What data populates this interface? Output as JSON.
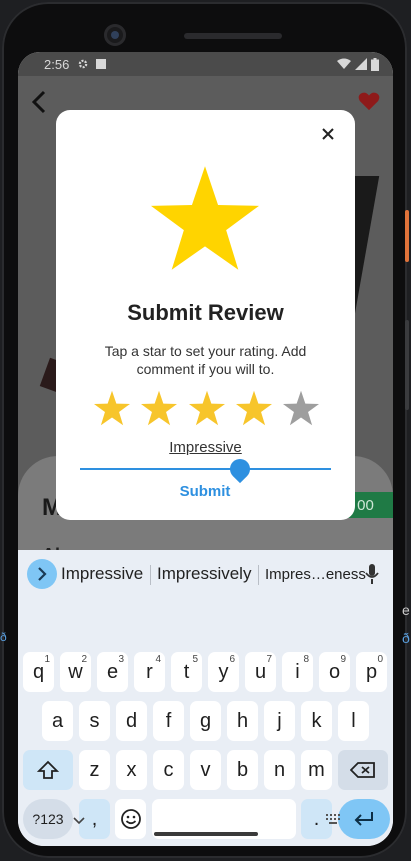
{
  "status_bar": {
    "time": "2:56"
  },
  "app": {
    "product_title": "M",
    "price_fragment": "00",
    "about_fragment": "Ab"
  },
  "dialog": {
    "title": "Submit Review",
    "message": "Tap a star to set your rating. Add comment if you will to.",
    "rating": 4,
    "max_rating": 5,
    "comment_value": "Impressive",
    "submit_label": "Submit",
    "colors": {
      "star_filled": "#f7c52b",
      "big_star": "#ffd400",
      "star_empty": "#9e9e9e",
      "accent": "#2e90e0"
    }
  },
  "keyboard": {
    "suggestions": [
      "Impressive",
      "Impressively",
      "Impres…eness"
    ],
    "row1": [
      {
        "k": "q",
        "n": "1"
      },
      {
        "k": "w",
        "n": "2"
      },
      {
        "k": "e",
        "n": "3"
      },
      {
        "k": "r",
        "n": "4"
      },
      {
        "k": "t",
        "n": "5"
      },
      {
        "k": "y",
        "n": "6"
      },
      {
        "k": "u",
        "n": "7"
      },
      {
        "k": "i",
        "n": "8"
      },
      {
        "k": "o",
        "n": "9"
      },
      {
        "k": "p",
        "n": "0"
      }
    ],
    "row2": [
      "a",
      "s",
      "d",
      "f",
      "g",
      "h",
      "j",
      "k",
      "l"
    ],
    "row3": [
      "z",
      "x",
      "c",
      "v",
      "b",
      "n",
      "m"
    ],
    "symbols_label": "?123",
    "comma_label": ",",
    "period_label": "."
  },
  "edge_fragments": {
    "right1": "e",
    "right2": "ð",
    "left": "ð"
  }
}
